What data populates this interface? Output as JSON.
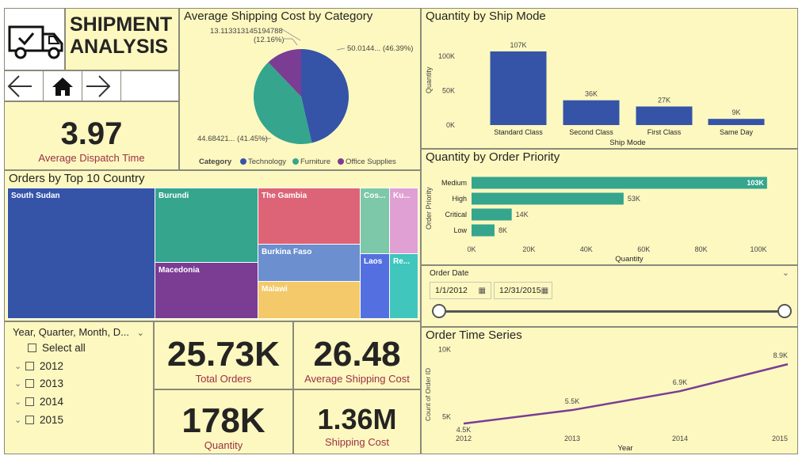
{
  "header": {
    "title_line1": "SHIPMENT",
    "title_line2": "ANALYSIS",
    "truck_icon": "truck-check-icon",
    "nav": {
      "back": "arrow-left-icon",
      "home": "home-icon",
      "forward": "arrow-right-icon"
    }
  },
  "kpis": {
    "dispatch_time": {
      "value": "3.97",
      "label": "Average Dispatch Time"
    },
    "total_orders": {
      "value": "25.73K",
      "label": "Total Orders"
    },
    "avg_shipping_cost": {
      "value": "26.48",
      "label": "Average Shipping Cost"
    },
    "quantity": {
      "value": "178K",
      "label": "Quantity"
    },
    "shipping_cost": {
      "value": "1.36M",
      "label": "Shipping Cost"
    }
  },
  "slicer": {
    "title": "Year, Quarter, Month, D...",
    "select_all": "Select all",
    "items": [
      "2012",
      "2013",
      "2014",
      "2015"
    ]
  },
  "date_filter": {
    "title": "Order Date",
    "start": "1/1/2012",
    "end": "12/31/2015",
    "range_selected": [
      0,
      1
    ]
  },
  "pie": {
    "title": "Average Shipping Cost by Category",
    "legend_title": "Category",
    "colors": [
      "#3554a8",
      "#35a58e",
      "#7b3c94"
    ],
    "chart_data": {
      "type": "pie",
      "labels": [
        "Technology",
        "Furniture",
        "Office Supplies"
      ],
      "values": [
        50.0144,
        44.68421,
        13.113313145194788
      ],
      "percent_labels": [
        "50.0144... (46.39%)",
        "44.68421... (41.45%)",
        "13.113313145194788 (12.16%)"
      ]
    },
    "callouts": {
      "technology": "50.0144... (46.39%)",
      "furniture": "44.68421... (41.45%)",
      "office_line1": "13.113313145194788",
      "office_line2": "(12.16%)"
    }
  },
  "ship_mode": {
    "title": "Quantity by Ship Mode",
    "color": "#3554a8",
    "chart_data": {
      "type": "bar",
      "categories": [
        "Standard Class",
        "Second Class",
        "First Class",
        "Same Day"
      ],
      "values": [
        107000,
        36000,
        27000,
        9000
      ],
      "data_labels": [
        "107K",
        "36K",
        "27K",
        "9K"
      ],
      "xlabel": "Ship Mode",
      "ylabel": "Quantity",
      "yticks": [
        "0K",
        "50K",
        "100K"
      ],
      "ylim": [
        0,
        115000
      ]
    }
  },
  "priority": {
    "title": "Quantity by Order Priority",
    "color": "#35a58e",
    "chart_data": {
      "type": "bar",
      "orientation": "horizontal",
      "categories": [
        "Medium",
        "High",
        "Critical",
        "Low"
      ],
      "values": [
        103000,
        53000,
        14000,
        8000
      ],
      "data_labels": [
        "103K",
        "53K",
        "14K",
        "8K"
      ],
      "xlabel": "Quantity",
      "ylabel": "Order Priority",
      "xticks": [
        "0K",
        "20K",
        "40K",
        "60K",
        "80K",
        "100K"
      ],
      "xlim": [
        0,
        100000
      ]
    }
  },
  "treemap": {
    "title": "Orders by Top 10 Country",
    "chart_data": {
      "type": "treemap",
      "labels": [
        "South Sudan",
        "Burundi",
        "Macedonia",
        "The Gambia",
        "Burkina Faso",
        "Malawi",
        "Cos...",
        "Laos",
        "Ku...",
        "Re..."
      ],
      "colors": [
        "#3554a8",
        "#35a58e",
        "#7b3c94",
        "#dd6476",
        "#6b8fcf",
        "#f3c96a",
        "#7cc8a9",
        "#5470e0",
        "#e0a0d4",
        "#40c6bc"
      ]
    }
  },
  "timeseries": {
    "title": "Order Time Series",
    "color": "#7b3c94",
    "chart_data": {
      "type": "line",
      "x": [
        "2012",
        "2013",
        "2014",
        "2015"
      ],
      "values": [
        4500,
        5500,
        6900,
        8900
      ],
      "data_labels": [
        "4.5K",
        "5.5K",
        "6.9K",
        "8.9K"
      ],
      "xlabel": "Year",
      "ylabel": "Count of Order ID",
      "yticks": [
        "5K",
        "10K"
      ],
      "ylim": [
        3800,
        10200
      ]
    }
  }
}
